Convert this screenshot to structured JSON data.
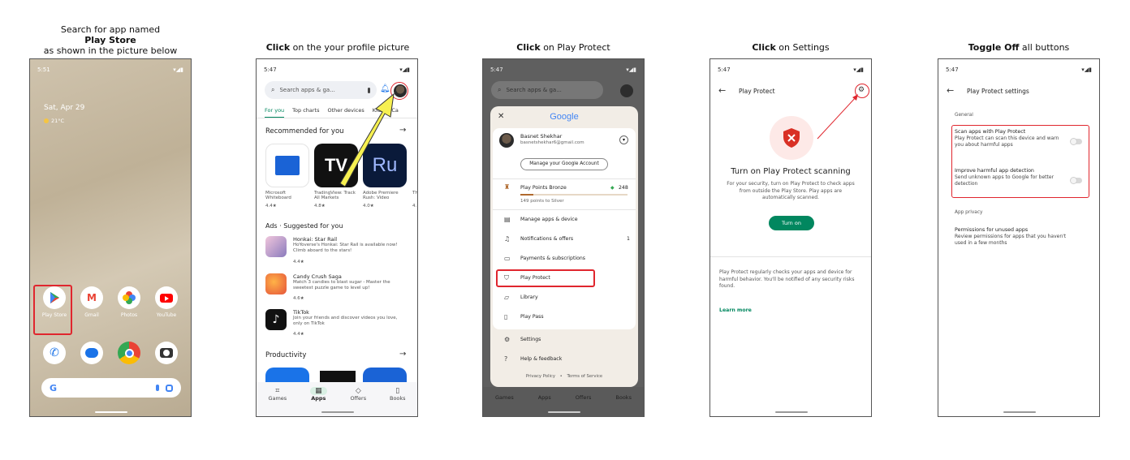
{
  "captions": {
    "step1_line1": "Search for app named",
    "step1_line2": "Play Store",
    "step1_line3": "as shown in the picture below",
    "step2_bold": "Click",
    "step2_rest": " on the your profile picture",
    "step3_bold": "Click",
    "step3_rest": " on Play Protect",
    "step4_bold": "Click",
    "step4_rest": " on Settings",
    "step5_bold": "Toggle Off",
    "step5_rest": " all buttons"
  },
  "screen1": {
    "time": "5:51",
    "status": "▾◢▮",
    "date": "Sat, Apr 29",
    "weather": "21°C",
    "apps_row1": [
      "Play Store",
      "Gmail",
      "Photos",
      "YouTube"
    ],
    "search_logo": "G"
  },
  "screen2": {
    "time": "5:47",
    "status": "▾◢▮",
    "search_placeholder": "Search apps & ga...",
    "tabs": [
      "For you",
      "Top charts",
      "Other devices",
      "Kids",
      "Ca"
    ],
    "recommended_title": "Recommended for you",
    "recommended": [
      {
        "name": "Microsoft Whiteboard",
        "rating": "4.4★"
      },
      {
        "name": "TradingView: Track All Markets",
        "rating": "4.8★"
      },
      {
        "name": "Adobe Premiere Rush: Video",
        "rating": "4.0★"
      },
      {
        "name": "Th",
        "rating": "4."
      }
    ],
    "suggested_title": "Ads · Suggested for you",
    "suggested": [
      {
        "name": "Honkai: Star Rail",
        "desc": "HoYoverse's Honkai: Star Rail is available now! Climb aboard to the stars!",
        "rating": "4.4★"
      },
      {
        "name": "Candy Crush Saga",
        "desc": "Match 3 candies to blast sugar - Master the sweetest puzzle game to level up!",
        "rating": "4.6★"
      },
      {
        "name": "TikTok",
        "desc": "Join your friends and discover videos you love, only on TikTok",
        "rating": "4.4★"
      }
    ],
    "productivity_title": "Productivity",
    "bottom_nav": [
      "Games",
      "Apps",
      "Offers",
      "Books"
    ]
  },
  "screen3": {
    "time": "5:47",
    "status": "▾◢▮",
    "search_placeholder": "Search apps & ga...",
    "google": "Google",
    "user_name": "Basnet Shekhar",
    "user_email": "basnetshekhar6@gmail.com",
    "manage_account": "Manage your Google Account",
    "points_title": "Play Points Bronze",
    "points_value": "248",
    "points_sub": "149 points to Silver",
    "menu": [
      "Manage apps & device",
      "Notifications & offers",
      "Payments & subscriptions",
      "Play Protect",
      "Library",
      "Play Pass",
      "Settings",
      "Help & feedback"
    ],
    "notif_count": "1",
    "privacy": "Privacy Policy",
    "terms": "Terms of Service",
    "dot": "•",
    "bottom_nav": [
      "Games",
      "Apps",
      "Offers",
      "Books"
    ]
  },
  "screen4": {
    "time": "5:47",
    "status": "▾◢▮",
    "title": "Play Protect",
    "heading": "Turn on Play Protect scanning",
    "body": "For your security, turn on Play Protect to check apps from outside the Play Store. Play apps are automatically scanned.",
    "button": "Turn on",
    "info": "Play Protect regularly checks your apps and device for harmful behavior. You'll be notified of any security risks found.",
    "learn_more": "Learn more"
  },
  "screen5": {
    "time": "5:47",
    "status": "▾◢▮",
    "title": "Play Protect settings",
    "general": "General",
    "opt1_title": "Scan apps with Play Protect",
    "opt1_desc": "Play Protect can scan this device and warn you about harmful apps",
    "opt2_title": "Improve harmful app detection",
    "opt2_desc": "Send unknown apps to Google for better detection",
    "privacy_header": "App privacy",
    "perm_title": "Permissions for unused apps",
    "perm_desc": "Review permissions for apps that you haven't used in a few months"
  }
}
